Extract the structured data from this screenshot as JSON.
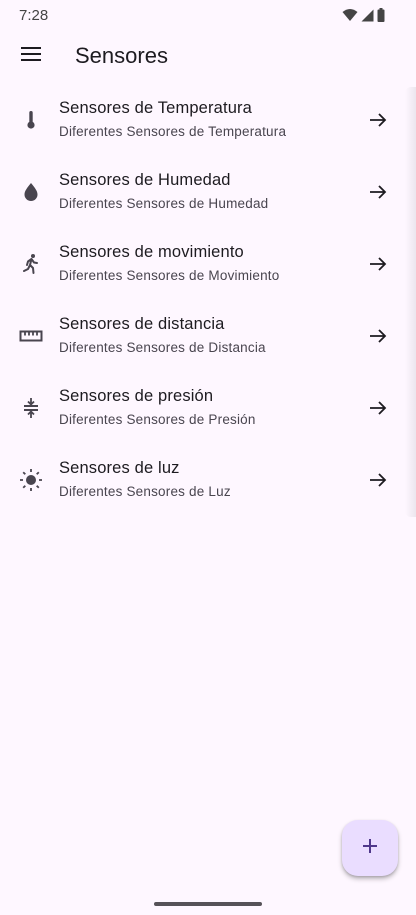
{
  "status_bar": {
    "time": "7:28",
    "icons": [
      "wifi-icon",
      "signal-icon",
      "battery-icon"
    ]
  },
  "app_bar": {
    "title": "Sensores",
    "menu_icon": "menu-icon"
  },
  "sensors": [
    {
      "title": "Sensores de Temperatura",
      "subtitle": "Diferentes Sensores de Temperatura",
      "icon": "thermometer-icon"
    },
    {
      "title": "Sensores de Humedad",
      "subtitle": "Diferentes Sensores de Humedad",
      "icon": "water-drop-icon"
    },
    {
      "title": "Sensores de movimiento",
      "subtitle": "Diferentes Sensores de Movimiento",
      "icon": "running-person-icon"
    },
    {
      "title": "Sensores de distancia",
      "subtitle": "Diferentes Sensores de Distancia",
      "icon": "ruler-icon"
    },
    {
      "title": "Sensores de presión",
      "subtitle": "Diferentes Sensores de Presión",
      "icon": "compress-icon"
    },
    {
      "title": "Sensores de luz",
      "subtitle": "Diferentes Sensores de Luz",
      "icon": "sun-icon"
    }
  ],
  "fab": {
    "icon": "plus-icon"
  },
  "colors": {
    "background": "#fef7ff",
    "text_primary": "#1d1b20",
    "text_secondary": "#49454f",
    "fab_background": "#eaddff",
    "fab_icon": "#4f378b"
  }
}
